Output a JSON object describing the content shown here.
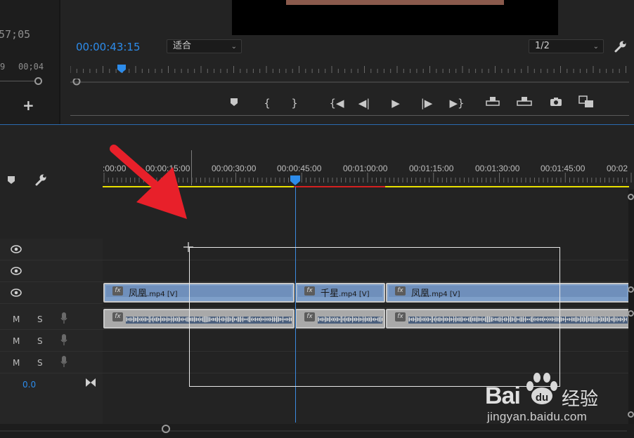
{
  "monitor": {
    "left_timecode_partial": "57;05",
    "left_ruler_labels": [
      "9",
      "00;04"
    ],
    "timecode": "00:00:43:15",
    "fit_dropdown": "适合",
    "resolution_dropdown": "1/2"
  },
  "transport": {
    "buttons": [
      "add-marker",
      "mark-in",
      "mark-out",
      "go-to-in",
      "step-back",
      "play",
      "step-forward",
      "go-to-out",
      "lift",
      "extract",
      "export-frame",
      "compare"
    ]
  },
  "timeline": {
    "ruler_labels": [
      ":00:00",
      "00:00:15:00",
      "00:00:30:00",
      "00:00:45:00",
      "00:01:00:00",
      "00:01:15:00",
      "00:01:30:00",
      "00:01:45:00",
      "00:02"
    ],
    "playhead_time": "00:00:43:15"
  },
  "tracks": {
    "audio_labels": {
      "m": "M",
      "s": "S"
    },
    "volume_value": "0.0"
  },
  "clips": {
    "video": [
      {
        "name": "凤凰",
        "ext": ".mp4 [V]"
      },
      {
        "name": "千星",
        "ext": ".mp4 [V]"
      },
      {
        "name": "凤凰",
        "ext": ".mp4 [V]"
      }
    ],
    "fx_label": "fx"
  },
  "colors": {
    "accent_blue": "#2d8ceb",
    "video_clip": "#7e9fc9",
    "audio_clip": "#a9a9a9",
    "work_area_yellow": "#e8e000",
    "render_red": "#d42020",
    "annotation_arrow": "#e8202a"
  },
  "watermark": {
    "brand": "Bai",
    "brand_cn": "经验",
    "url": "jingyan.baidu.com"
  }
}
